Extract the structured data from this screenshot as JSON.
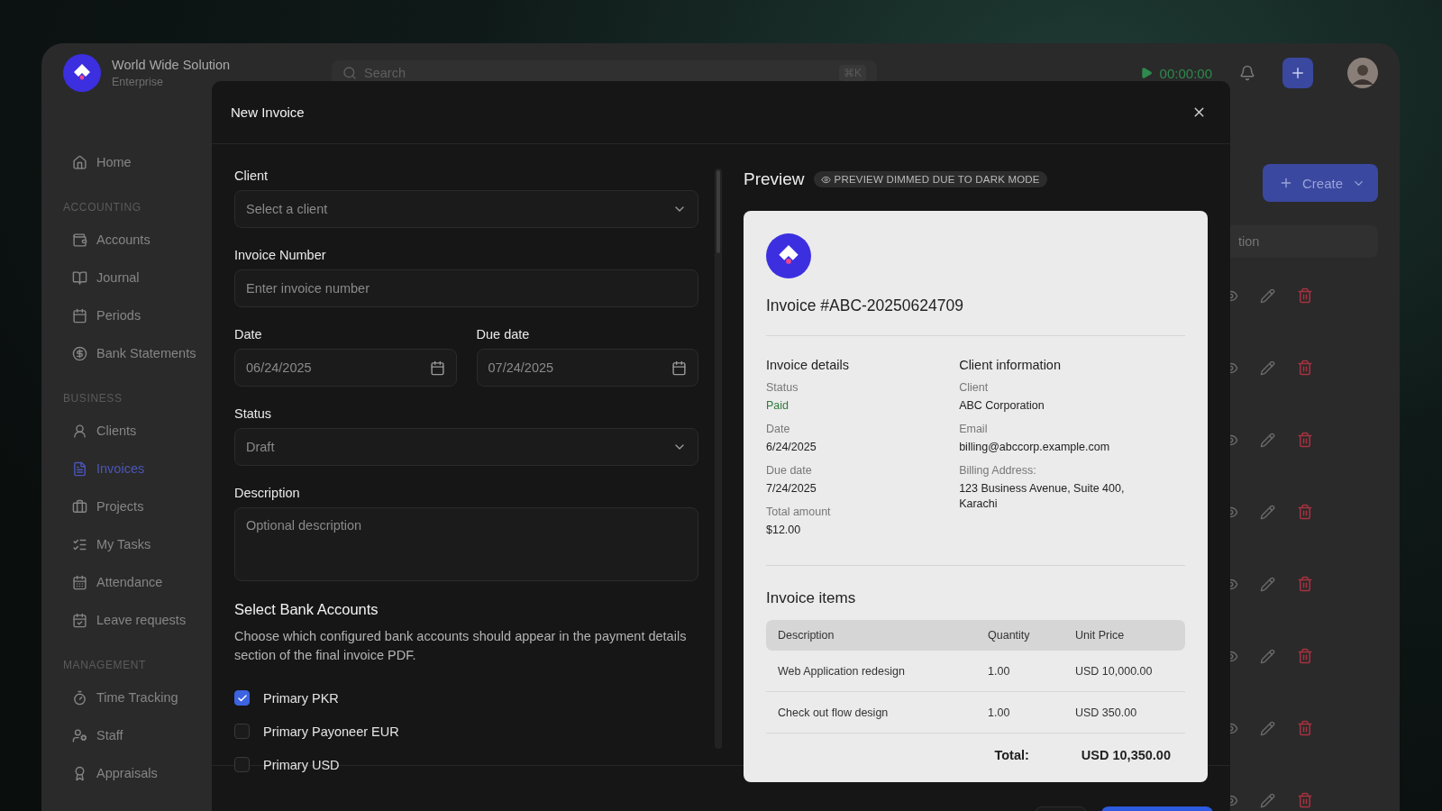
{
  "brand": {
    "name": "World Wide Solution",
    "subtitle": "Enterprise"
  },
  "search": {
    "placeholder": "Search",
    "shortcut": "⌘K"
  },
  "timer": "00:00:00",
  "sidebar": {
    "sections": [
      {
        "items": [
          {
            "label": "Home",
            "selected": false
          }
        ]
      },
      {
        "heading": "ACCOUNTING",
        "items": [
          {
            "label": "Accounts",
            "selected": false
          },
          {
            "label": "Journal",
            "selected": false
          },
          {
            "label": "Periods",
            "selected": false
          },
          {
            "label": "Bank Statements",
            "selected": false
          }
        ]
      },
      {
        "heading": "BUSINESS",
        "items": [
          {
            "label": "Clients",
            "selected": false
          },
          {
            "label": "Invoices",
            "selected": true
          },
          {
            "label": "Projects",
            "selected": false
          },
          {
            "label": "My Tasks",
            "selected": false
          },
          {
            "label": "Attendance",
            "selected": false
          },
          {
            "label": "Leave requests",
            "selected": false
          }
        ]
      },
      {
        "heading": "MANAGEMENT",
        "items": [
          {
            "label": "Time Tracking",
            "selected": false
          },
          {
            "label": "Staff",
            "selected": false
          },
          {
            "label": "Appraisals",
            "selected": false
          }
        ]
      }
    ]
  },
  "create_button": "Create",
  "table_search": {
    "placeholder": "tion"
  },
  "modal": {
    "title": "New Invoice",
    "fields": [
      {
        "kind": "select",
        "label": "Client",
        "placeholder": "Select a client"
      },
      {
        "kind": "input",
        "label": "Invoice Number",
        "placeholder": "Enter invoice number"
      },
      {
        "kind": "dates",
        "dates": [
          {
            "label": "Date",
            "value": "06/24/2025"
          },
          {
            "label": "Due date",
            "value": "07/24/2025"
          }
        ]
      },
      {
        "kind": "select",
        "label": "Status",
        "value": "Draft"
      },
      {
        "kind": "textarea",
        "label": "Description",
        "placeholder": "Optional description"
      }
    ],
    "bank_accounts": {
      "title": "Select Bank Accounts",
      "description": "Choose which configured bank accounts should appear in the payment details section of the final invoice PDF.",
      "accounts": [
        {
          "label": "Primary PKR",
          "checked": true
        },
        {
          "label": "Primary Payoneer EUR",
          "checked": false
        },
        {
          "label": "Primary USD",
          "checked": false
        }
      ]
    },
    "preview": {
      "title": "Preview",
      "badge": "PREVIEW DIMMED DUE TO DARK MODE",
      "invoice_title": "Invoice #ABC-20250624709",
      "details": [
        {
          "heading": "Invoice details",
          "fields": [
            {
              "label": "Status",
              "value": "Paid",
              "color": "#2f7a3c"
            },
            {
              "label": "Date",
              "value": "6/24/2025"
            },
            {
              "label": "Due date",
              "value": "7/24/2025"
            },
            {
              "label": "Total amount",
              "value": "$12.00"
            }
          ]
        },
        {
          "heading": "Client information",
          "fields": [
            {
              "label": "Client",
              "value": "ABC Corporation"
            },
            {
              "label": "Email",
              "value": "billing@abccorp.example.com"
            },
            {
              "label": "Billing Address:",
              "value": "123 Business Avenue, Suite 400, Karachi"
            }
          ]
        }
      ],
      "items_title": "Invoice items",
      "columns": [
        "Description",
        "Quantity",
        "Unit Price"
      ],
      "rows": [
        [
          "Web Application redesign",
          "1.00",
          "USD 10,000.00"
        ],
        [
          "Check out flow design",
          "1.00",
          "USD 350.00"
        ]
      ],
      "total_label": "Total:",
      "total_value": "USD 10,350.00"
    }
  }
}
